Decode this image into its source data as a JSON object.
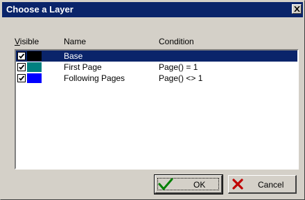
{
  "dialog": {
    "title": "Choose a Layer"
  },
  "columns": {
    "visible_prefix": "V",
    "visible_rest": "isible",
    "name": "Name",
    "condition": "Condition"
  },
  "layers": [
    {
      "visible": true,
      "color": "#000000",
      "name": "Base",
      "condition": "",
      "selected": true
    },
    {
      "visible": true,
      "color": "#008080",
      "name": "First Page",
      "condition": "Page() = 1",
      "selected": false
    },
    {
      "visible": true,
      "color": "#0000ff",
      "name": "Following Pages",
      "condition": "Page() <> 1",
      "selected": false
    }
  ],
  "buttons": {
    "ok_label": "OK",
    "cancel_label": "Cancel"
  },
  "icons": {
    "ok": "check-icon",
    "cancel": "cross-icon",
    "close": "close-icon"
  }
}
